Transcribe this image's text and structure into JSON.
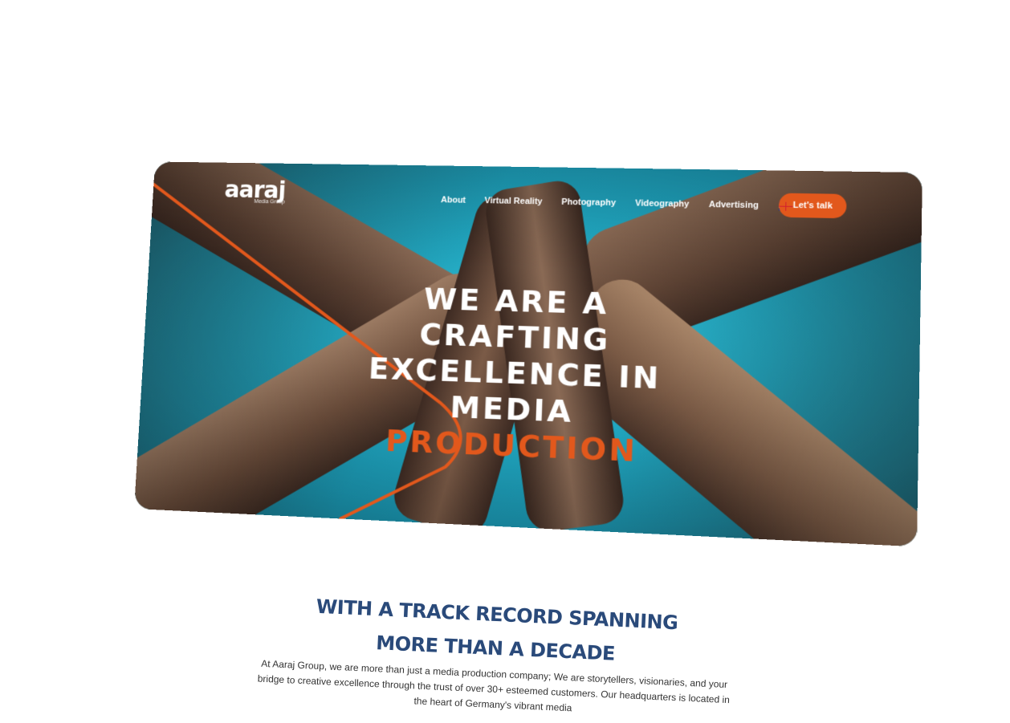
{
  "brand": {
    "logo_text": "aaraj",
    "logo_sub": "Media Group"
  },
  "nav": {
    "items": [
      "About",
      "Virtual Reality",
      "Photography",
      "Videography",
      "Advertising"
    ],
    "cta_label": "Let's talk",
    "language_flag": "uk-flag-icon"
  },
  "hero": {
    "line1": "WE ARE A CRAFTING",
    "line2": "EXCELLENCE IN",
    "line3_plain": "MEDIA",
    "line3_accent": "PRODUCTION"
  },
  "intro": {
    "title_line1": "WITH A TRACK RECORD SPANNING",
    "title_line2": "MORE THAN A DECADE",
    "body": "At Aaraj Group, we are more than just a media production company; We are storytellers, visionaries, and your bridge to creative excellence through the trust of over 30+ esteemed customers. Our headquarters is located in the heart of Germany's vibrant media"
  },
  "colors": {
    "accent": "#e2581c",
    "title_blue": "#2a4a7a",
    "sky": "#21a9c3"
  }
}
